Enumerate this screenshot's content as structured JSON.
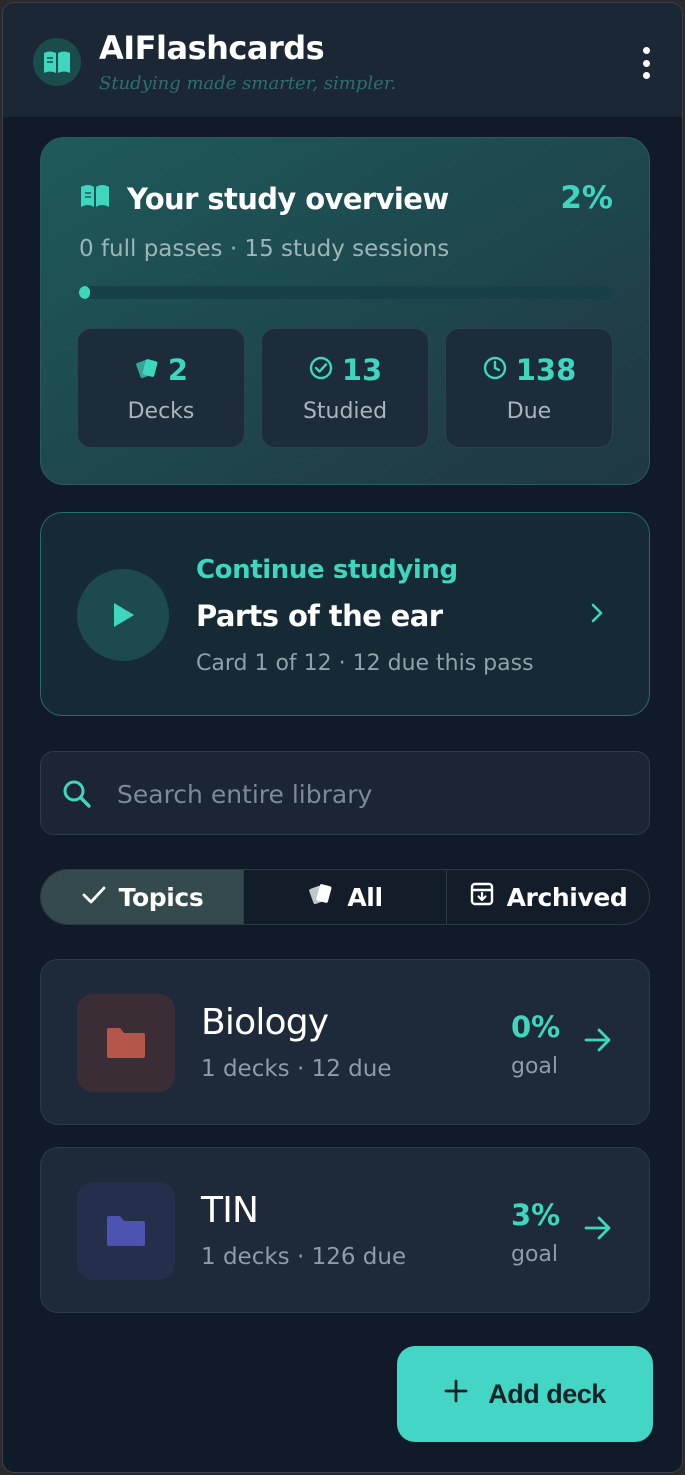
{
  "header": {
    "title": "AIFlashcards",
    "subtitle": "Studying made smarter, simpler."
  },
  "overview": {
    "title": "Your study overview",
    "percent": "2%",
    "progress_fraction": 0.02,
    "summary": "0 full passes · 15 study sessions",
    "stats": [
      {
        "icon": "cards-icon",
        "value": "2",
        "label": "Decks"
      },
      {
        "icon": "check-circle-icon",
        "value": "13",
        "label": "Studied"
      },
      {
        "icon": "clock-icon",
        "value": "138",
        "label": "Due"
      }
    ]
  },
  "continue": {
    "kicker": "Continue studying",
    "title": "Parts of the ear",
    "subtitle": "Card 1 of 12 · 12 due this pass"
  },
  "search": {
    "placeholder": "Search entire library",
    "value": ""
  },
  "tabs": [
    {
      "label": "Topics",
      "icon": "check-icon",
      "active": true
    },
    {
      "label": "All",
      "icon": "cards-icon",
      "active": false
    },
    {
      "label": "Archived",
      "icon": "archive-icon",
      "active": false
    }
  ],
  "topics": [
    {
      "name": "Biology",
      "meta": "1 decks · 12 due",
      "percent": "0%",
      "goal_label": "goal",
      "folder_color": "#b5564a",
      "tile_color": "#3a2d35"
    },
    {
      "name": "TIN",
      "meta": "1 decks · 126 due",
      "percent": "3%",
      "goal_label": "goal",
      "folder_color": "#4c53b0",
      "tile_color": "#252e4a"
    }
  ],
  "add_deck": {
    "label": "Add deck"
  },
  "colors": {
    "accent": "#3fd6c0",
    "background": "#111a29"
  }
}
